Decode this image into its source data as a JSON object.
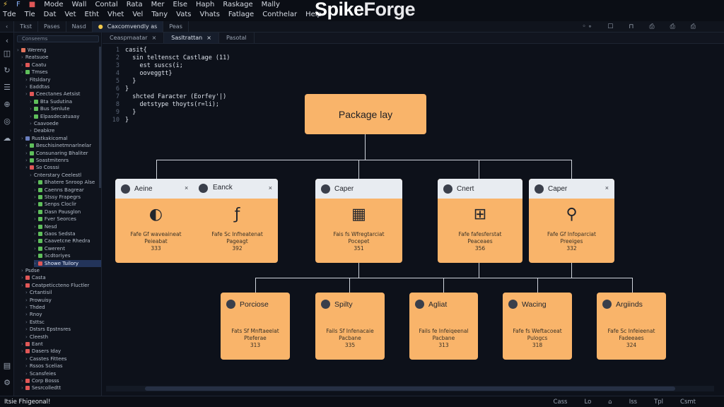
{
  "app": {
    "brand_a": "Spike",
    "brand_b": "Forge"
  },
  "menu": {
    "row1": [
      "Mode",
      "Wall",
      "Contal",
      "Rata",
      "Mer",
      "Else",
      "Haph",
      "Raskage",
      "Mally"
    ],
    "row2": [
      "Tde",
      "Tle",
      "Dat",
      "Vet",
      "Etht",
      "Vhet",
      "Vel",
      "Tany",
      "Vats",
      "Vhats",
      "Fatlage",
      "Conthelar",
      "Help"
    ]
  },
  "top_tabs": [
    "Tkst",
    "Pases",
    "Nasd",
    "Caxcomvendly as",
    "Peas"
  ],
  "top_right": [
    "◦ ∘",
    "☐",
    "⊓",
    "⎙",
    "⎙",
    "⎙"
  ],
  "editor_tabs": [
    "Ceaspmaatar",
    "Sasltrattan",
    "Pasotal"
  ],
  "tree": {
    "search": "Conseems",
    "items": [
      {
        "label": "Wereng",
        "depth": 0,
        "color": "#e2735c"
      },
      {
        "label": "Reatsuoe",
        "depth": 1,
        "color": ""
      },
      {
        "label": "Caatu",
        "depth": 1,
        "color": "#e05757"
      },
      {
        "label": "Tmses",
        "depth": 1,
        "color": "#5fbf5b"
      },
      {
        "label": "Fitsldary",
        "depth": 2,
        "color": ""
      },
      {
        "label": "Eaddtas",
        "depth": 2,
        "color": ""
      },
      {
        "label": "Ceectanes Aetsist",
        "depth": 2,
        "color": "#e05757"
      },
      {
        "label": "Bta Sudutina",
        "depth": 3,
        "color": "#5fbf5b"
      },
      {
        "label": "Bus Senlute",
        "depth": 3,
        "color": "#5fbf5b"
      },
      {
        "label": "Elpasdecatuaay",
        "depth": 3,
        "color": "#5fbf5b"
      },
      {
        "label": "Caavoede",
        "depth": 3,
        "color": ""
      },
      {
        "label": "Deabkre",
        "depth": 3,
        "color": ""
      },
      {
        "label": "Rustkakicomal",
        "depth": 1,
        "color": "#6a7fbf"
      },
      {
        "label": "Beschisinetmnarlnelar",
        "depth": 2,
        "color": "#5fbf5b"
      },
      {
        "label": "Consunaring Bhaliter",
        "depth": 2,
        "color": "#5fbf5b"
      },
      {
        "label": "Soastmitenrs",
        "depth": 2,
        "color": "#5fbf5b"
      },
      {
        "label": "So Cosssi",
        "depth": 2,
        "color": "#e05757"
      },
      {
        "label": "Cnterstary Ceelestl",
        "depth": 3,
        "color": ""
      },
      {
        "label": "Bhatere Snroop Alse",
        "depth": 4,
        "color": "#5fbf5b"
      },
      {
        "label": "Caenns Bagrear",
        "depth": 4,
        "color": "#5fbf5b"
      },
      {
        "label": "Stssy Frapegrs",
        "depth": 4,
        "color": "#5fbf5b"
      },
      {
        "label": "Senps Cloclir",
        "depth": 4,
        "color": "#5fbf5b"
      },
      {
        "label": "Dasn Pausglon",
        "depth": 4,
        "color": "#5fbf5b"
      },
      {
        "label": "Fver Seorces",
        "depth": 4,
        "color": "#5fbf5b"
      },
      {
        "label": "Nesd",
        "depth": 4,
        "color": "#5fbf5b"
      },
      {
        "label": "Gaos Sedsta",
        "depth": 4,
        "color": "#5fbf5b"
      },
      {
        "label": "Caavetcne Rhedra",
        "depth": 4,
        "color": "#5fbf5b"
      },
      {
        "label": "Cwerent",
        "depth": 4,
        "color": "#5fbf5b"
      },
      {
        "label": "Scdtoriyes",
        "depth": 4,
        "color": "#5fbf5b"
      },
      {
        "label": "Showe Tuilory",
        "depth": 4,
        "color": "#e05757"
      },
      {
        "label": "Psdse",
        "depth": 1,
        "color": ""
      },
      {
        "label": "Casta",
        "depth": 1,
        "color": "#e05757"
      },
      {
        "label": "Ceatpeticcteno Fluctler",
        "depth": 1,
        "color": "#e05757"
      },
      {
        "label": "Crtantisil",
        "depth": 2,
        "color": ""
      },
      {
        "label": "Prowuisy",
        "depth": 2,
        "color": ""
      },
      {
        "label": "Thded",
        "depth": 2,
        "color": ""
      },
      {
        "label": "Rnoy",
        "depth": 2,
        "color": ""
      },
      {
        "label": "Esttsc",
        "depth": 2,
        "color": ""
      },
      {
        "label": "Dstsrs Epstnsres",
        "depth": 2,
        "color": ""
      },
      {
        "label": "Cleesth",
        "depth": 2,
        "color": ""
      },
      {
        "label": "Eant",
        "depth": 1,
        "color": "#e05757"
      },
      {
        "label": "Dasers Iday",
        "depth": 1,
        "color": "#e05757"
      },
      {
        "label": "Casstes Fittees",
        "depth": 2,
        "color": ""
      },
      {
        "label": "Rssos Scelias",
        "depth": 2,
        "color": ""
      },
      {
        "label": "Scansfeies",
        "depth": 2,
        "color": ""
      },
      {
        "label": "Corp Bosss",
        "depth": 1,
        "color": "#e05757"
      },
      {
        "label": "Sesrcolledtt",
        "depth": 1,
        "color": "#e05757"
      }
    ]
  },
  "code": [
    {
      "n": "1",
      "t": "casit{"
    },
    {
      "n": "2",
      "t": "  sin teltensct Castlage (11)"
    },
    {
      "n": "3",
      "t": "    est suscs(i;"
    },
    {
      "n": "4",
      "t": "    ooveggtt}"
    },
    {
      "n": "5",
      "t": "  }"
    },
    {
      "n": "6",
      "t": "}"
    },
    {
      "n": "7",
      "t": "  shcted Faracter (Eorfey'|)"
    },
    {
      "n": "8",
      "t": "    detstype thoyts(r=li);"
    },
    {
      "n": "9",
      "t": "  }"
    },
    {
      "n": "10",
      "t": "}"
    }
  ],
  "diagram": {
    "root": "Package lay",
    "top_cards": [
      {
        "left": "Aeine",
        "right": "Eanck",
        "left_icon": "◐",
        "right_icon": "ƒ",
        "left_desc": [
          "Fafe Gf waveaineat",
          "Peieabat",
          "333"
        ],
        "right_desc": [
          "Fafe Sc Infheatenat",
          "Pageagt",
          "392"
        ]
      },
      {
        "title": "Caper",
        "icon": "▦",
        "desc": [
          "Fais fs Wfregtarciat",
          "Pocepet",
          "351"
        ]
      },
      {
        "title": "Cnert",
        "icon": "⊞",
        "desc": [
          "Fafe fafesferstat",
          "Peaceaes",
          "356"
        ]
      },
      {
        "title": "Caper",
        "icon": "⚲",
        "desc": [
          "Fafe Gf Infoparciat",
          "Preeiges",
          "332"
        ]
      }
    ],
    "bottom_cards": [
      {
        "title": "Porciose",
        "desc": [
          "Fats Sf Mnftaeelat",
          "Pteferae",
          "313"
        ]
      },
      {
        "title": "Spilty",
        "desc": [
          "Fails Sf Infenacaie",
          "Pacbane",
          "335"
        ]
      },
      {
        "title": "Agliat",
        "desc": [
          "Fails fe Infeiqeenal",
          "Pacbane",
          "313"
        ]
      },
      {
        "title": "Wacing",
        "desc": [
          "Fafe fs Weftacoeat",
          "Pulogcs",
          "318"
        ]
      },
      {
        "title": "Argiinds",
        "desc": [
          "Fafe Sc Infeieenat",
          "Fadeeaes",
          "324"
        ]
      }
    ]
  },
  "status": {
    "left": "Itsie Fhigeonal!",
    "right": [
      "Cass",
      "Lo",
      "⌂",
      "Iss",
      "Tpl",
      "Csmt"
    ]
  },
  "colors": {
    "accent": "#f9b46a",
    "card_header": "#e8ecf1",
    "background": "#0d111a"
  }
}
